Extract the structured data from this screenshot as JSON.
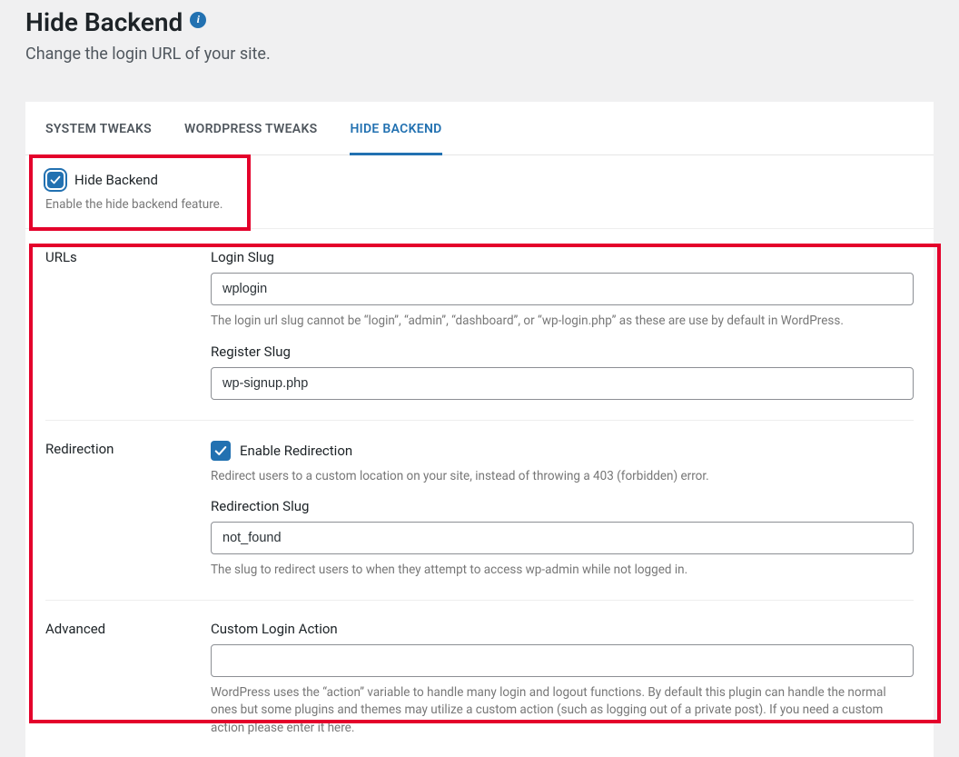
{
  "header": {
    "title": "Hide Backend",
    "info_glyph": "i",
    "subtitle": "Change the login URL of your site."
  },
  "tabs": {
    "system": "SYSTEM TWEAKS",
    "wordpress": "WORDPRESS TWEAKS",
    "hide": "HIDE BACKEND"
  },
  "top_section": {
    "checkbox_label": "Hide Backend",
    "desc": "Enable the hide backend feature."
  },
  "groups": {
    "urls": {
      "title": "URLs",
      "login_slug_label": "Login Slug",
      "login_slug_value": "wplogin",
      "login_slug_help": "The login url slug cannot be “login”, “admin”, “dashboard”, or “wp-login.php” as these are use by default in WordPress.",
      "register_slug_label": "Register Slug",
      "register_slug_value": "wp-signup.php"
    },
    "redirection": {
      "title": "Redirection",
      "enable_label": "Enable Redirection",
      "enable_help": "Redirect users to a custom location on your site, instead of throwing a 403 (forbidden) error.",
      "slug_label": "Redirection Slug",
      "slug_value": "not_found",
      "slug_help": "The slug to redirect users to when they attempt to access wp-admin while not logged in."
    },
    "advanced": {
      "title": "Advanced",
      "action_label": "Custom Login Action",
      "action_value": "",
      "action_help": "WordPress uses the “action” variable to handle many login and logout functions. By default this plugin can handle the normal ones but some plugins and themes may utilize a custom action (such as logging out of a private post). If you need a custom action please enter it here."
    }
  }
}
